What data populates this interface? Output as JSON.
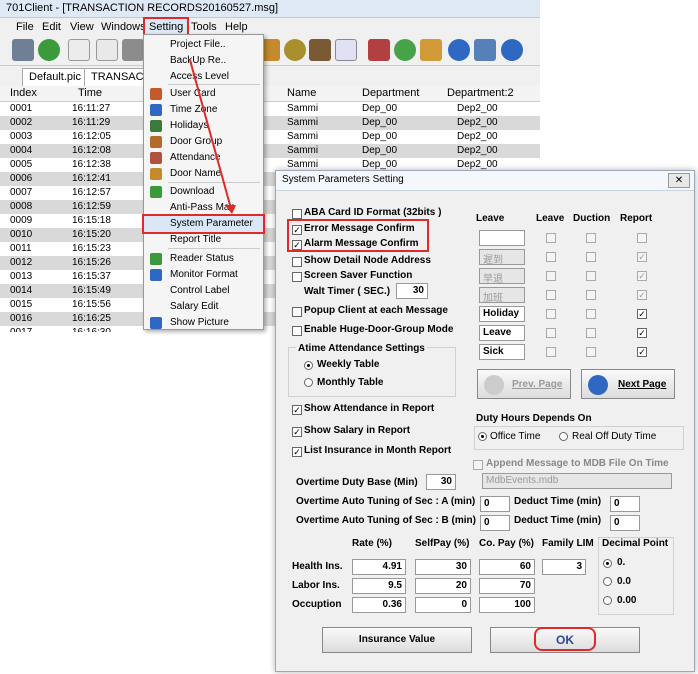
{
  "window": {
    "title": "701Client - [TRANSACTION RECORDS20160527.msg]"
  },
  "menu": [
    "File",
    "Edit",
    "View",
    "Windows",
    "Setting",
    "Tools",
    "Help"
  ],
  "tabs": [
    "Default.pic",
    "TRANSACTI"
  ],
  "grid": {
    "headers": [
      "Index",
      "Time",
      "Name",
      "Department",
      "Department:2"
    ],
    "rows": [
      [
        "0001",
        "16:11:27",
        "Sammi",
        "Dep_00",
        "Dep2_00"
      ],
      [
        "0002",
        "16:11:29",
        "Sammi",
        "Dep_00",
        "Dep2_00"
      ],
      [
        "0003",
        "16:12:05",
        "Sammi",
        "Dep_00",
        "Dep2_00"
      ],
      [
        "0004",
        "16:12:08",
        "Sammi",
        "Dep_00",
        "Dep2_00"
      ],
      [
        "0005",
        "16:12:38",
        "Sammi",
        "Dep_00",
        "Dep2_00"
      ],
      [
        "0006",
        "16:12:41",
        "",
        "",
        ""
      ],
      [
        "0007",
        "16:12:57",
        "",
        "",
        ""
      ],
      [
        "0008",
        "16:12:59",
        "",
        "",
        ""
      ],
      [
        "0009",
        "16:15:18",
        "",
        "",
        ""
      ],
      [
        "0010",
        "16:15:20",
        "",
        "",
        ""
      ],
      [
        "0011",
        "16:15:23",
        "",
        "",
        ""
      ],
      [
        "0012",
        "16:15:26",
        "",
        "",
        ""
      ],
      [
        "0013",
        "16:15:37",
        "",
        "",
        ""
      ],
      [
        "0014",
        "16:15:49",
        "",
        "",
        ""
      ],
      [
        "0015",
        "16:15:56",
        "",
        "",
        ""
      ],
      [
        "0016",
        "16:16:25",
        "",
        "",
        ""
      ],
      [
        "0017",
        "16:16:30",
        "",
        "",
        ""
      ]
    ]
  },
  "setting_menu": [
    "Project File..",
    "BackUp Re..",
    "Access Level",
    "User Card",
    "Time Zone",
    "Holidays",
    "Door Group",
    "Attendance",
    "Door Name",
    "Download",
    "Anti-Pass Map",
    "System Parameter",
    "Report Title",
    "Reader Status",
    "Monitor Format",
    "Control Label",
    "Salary Edit",
    "Show Picture"
  ],
  "dialog": {
    "title": "System Parameters Setting",
    "close": "✕",
    "options": [
      {
        "label": "ABA Card ID Format (32bits )",
        "checked": false
      },
      {
        "label": "Error Message Confirm",
        "checked": true
      },
      {
        "label": "Alarm Message Confirm",
        "checked": true
      },
      {
        "label": "Show Detail Node Address",
        "checked": false
      },
      {
        "label": "Screen Saver Function",
        "checked": false
      },
      {
        "label": "Popup Client at each Message",
        "checked": false
      },
      {
        "label": "Enable Huge-Door-Group Mode",
        "checked": false
      }
    ],
    "wait_timer_label": "Walt Timer ( SEC.)",
    "wait_timer_value": "30",
    "attendance_group": "Atime Attendance Settings",
    "weekly": "Weekly Table",
    "monthly": "Monthly Table",
    "report_opts": [
      {
        "label": "Show Attendance in Report",
        "checked": true
      },
      {
        "label": "Show Salary in Report",
        "checked": true
      },
      {
        "label": "List Insurance in Month Report",
        "checked": true
      }
    ],
    "leave_headers": [
      "Leave",
      "Leave",
      "Duction",
      "Report"
    ],
    "leave_rows": [
      {
        "name": "",
        "leave": false,
        "duction": false,
        "report": false,
        "enabled": true
      },
      {
        "name": "遲到",
        "leave": false,
        "duction": false,
        "report": true,
        "enabled": false
      },
      {
        "name": "早退",
        "leave": false,
        "duction": false,
        "report": true,
        "enabled": false
      },
      {
        "name": "加班",
        "leave": false,
        "duction": false,
        "report": true,
        "enabled": false
      },
      {
        "name": "Holiday",
        "leave": false,
        "duction": false,
        "report": true,
        "enabled": true
      },
      {
        "name": "Leave",
        "leave": false,
        "duction": false,
        "report": true,
        "enabled": true
      },
      {
        "name": "Sick",
        "leave": false,
        "duction": false,
        "report": true,
        "enabled": true
      }
    ],
    "prev_page": "Prev. Page",
    "next_page": "Next Page",
    "duty_group": "Duty Hours Depends On",
    "office_time": "Office Time",
    "real_off": "Real Off Duty Time",
    "append_label": "Append Message to MDB File On Time",
    "mdb_file": "MdbEvents.mdb",
    "ot_base_label": "Overtime Duty Base (Min)",
    "ot_base_value": "30",
    "ot_a_label": "Overtime Auto Tuning of Sec : A (min)",
    "ot_a_value": "0",
    "ot_b_label": "Overtime Auto Tuning of Sec : B (min)",
    "ot_b_value": "0",
    "deduct_label": "Deduct Time (min)",
    "deduct_a": "0",
    "deduct_b": "0",
    "ins_headers": [
      "Rate  (%)",
      "SelfPay (%)",
      "Co. Pay (%)",
      "Family LIM"
    ],
    "ins_rows": [
      {
        "name": "Health Ins.",
        "rate": "4.91",
        "self": "30",
        "co": "60",
        "fam": "3"
      },
      {
        "name": "Labor Ins.",
        "rate": "9.5",
        "self": "20",
        "co": "70",
        "fam": ""
      },
      {
        "name": "Occuption",
        "rate": "0.36",
        "self": "0",
        "co": "100",
        "fam": ""
      }
    ],
    "decimal_group": "Decimal Point",
    "decimal_opts": [
      "0.",
      "0.0",
      "0.00"
    ],
    "insurance_btn": "Insurance Value",
    "ok_btn": "OK"
  }
}
